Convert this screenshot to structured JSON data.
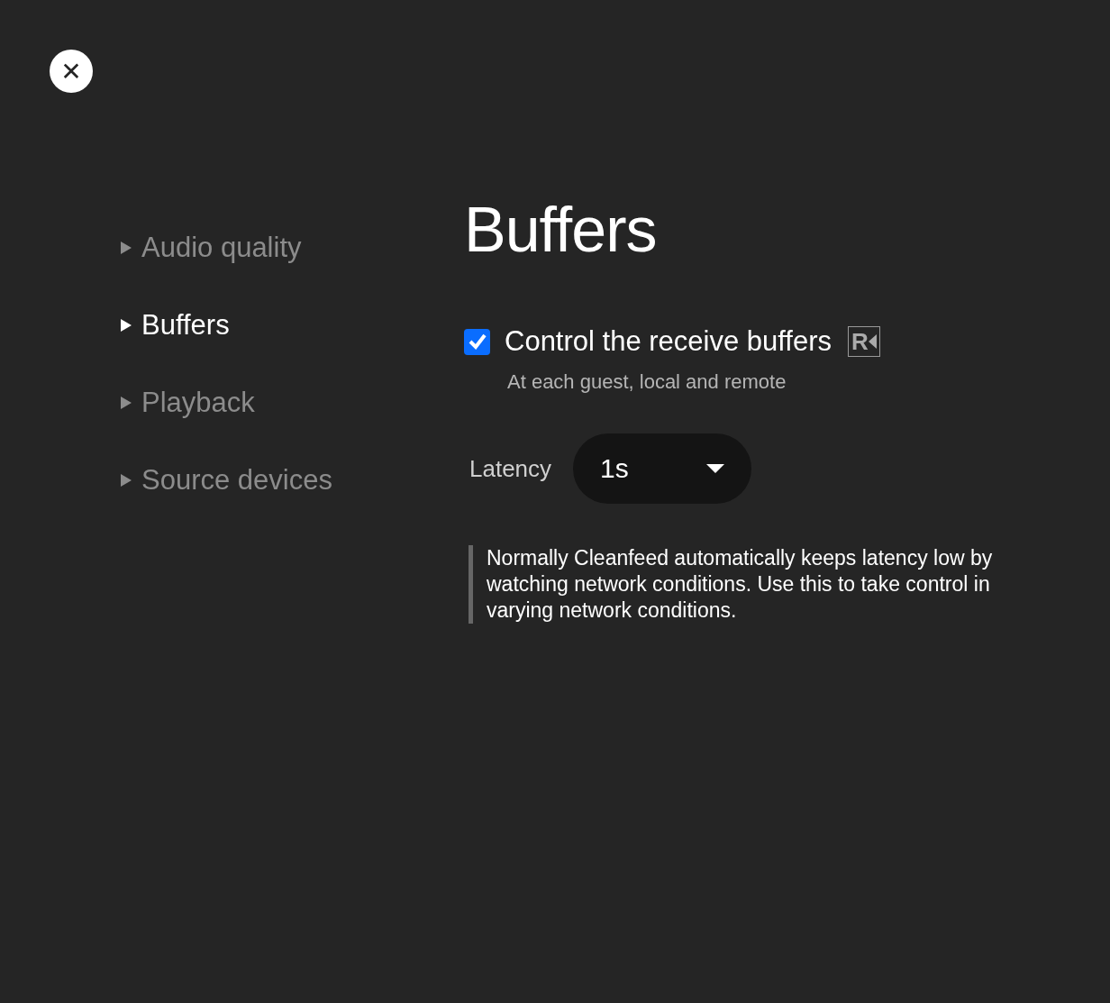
{
  "close_button": {
    "label": "✕"
  },
  "sidebar": {
    "items": [
      {
        "label": "Audio quality",
        "selected": false
      },
      {
        "label": "Buffers",
        "selected": true
      },
      {
        "label": "Playback",
        "selected": false
      },
      {
        "label": "Source devices",
        "selected": false
      }
    ]
  },
  "panel": {
    "title": "Buffers",
    "checkbox": {
      "label": "Control the receive buffers",
      "checked": true,
      "badge": "R",
      "hint": "At each guest, local and remote"
    },
    "latency": {
      "label": "Latency",
      "value": "1s"
    },
    "note": "Normally Cleanfeed automatically keeps latency low by watching network conditions. Use this to take control in varying network conditions."
  }
}
